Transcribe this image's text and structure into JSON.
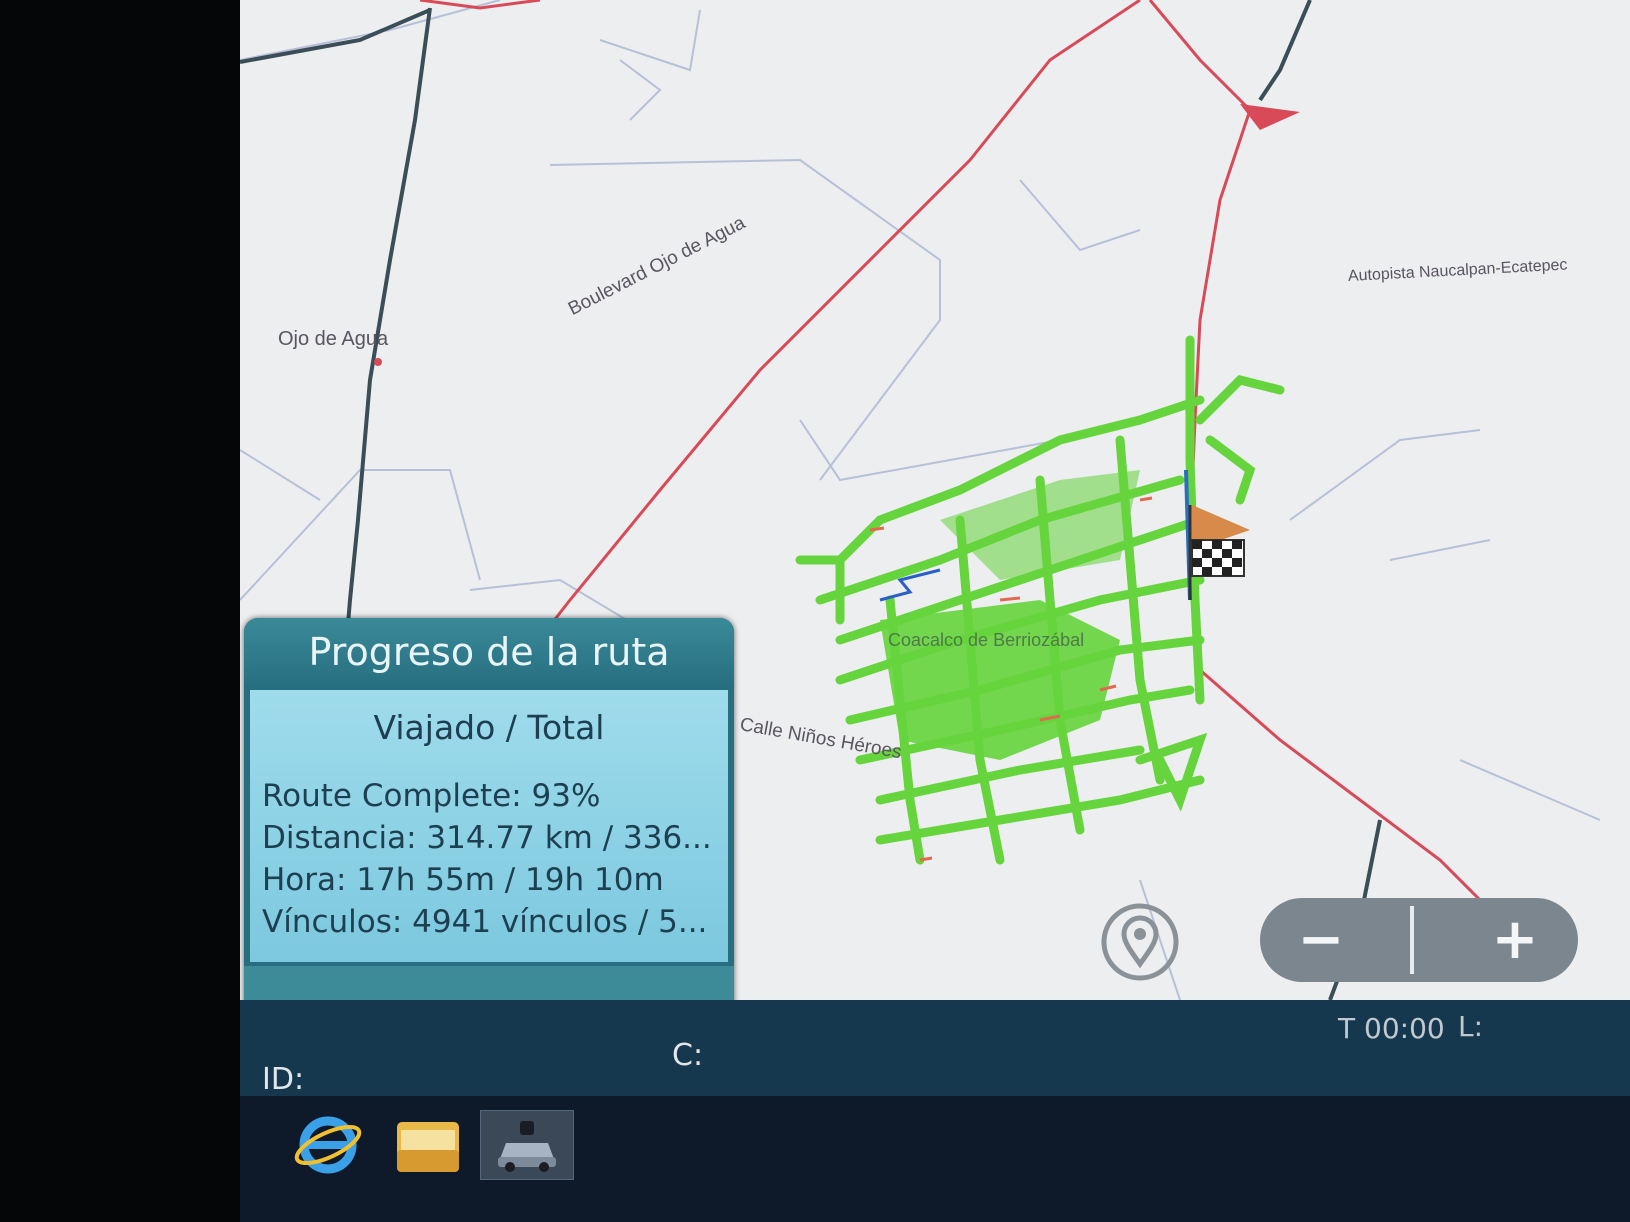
{
  "map": {
    "labels": {
      "boulevard": "Boulevard Ojo de Agua",
      "ojo_de_agua": "Ojo de Agua",
      "autopista": "Autopista Naucalpan-Ecatepec",
      "coacalco": "Coacalco de Berriozábal",
      "calle_ninos": "Calle Niños Héroes"
    },
    "colors": {
      "background": "#eceef0",
      "route": "#d84a58",
      "coverage": "#66d43c",
      "major_road": "#3b4e58",
      "minor_road": "#b8c0d8"
    },
    "markers": [
      "destination-flag-icon",
      "route-arrow-icon"
    ]
  },
  "progress_panel": {
    "title": "Progreso de la ruta",
    "subtitle": "Viajado / Total",
    "route_complete": "Route Complete: 93%",
    "distance": "Distancia: 314.77 km / 336...",
    "time": "Hora: 17h 55m / 19h 10m",
    "links": "Vínculos: 4941 vínculos / 5..."
  },
  "zoom": {
    "minus": "−",
    "plus": "+"
  },
  "status_bar": {
    "id_label": "ID:",
    "c_label": "C:",
    "time": "T 00:00",
    "l_label": "L:"
  },
  "taskbar": {
    "icons": [
      "internet-explorer-icon",
      "folder-icon",
      "car-app-icon"
    ]
  }
}
